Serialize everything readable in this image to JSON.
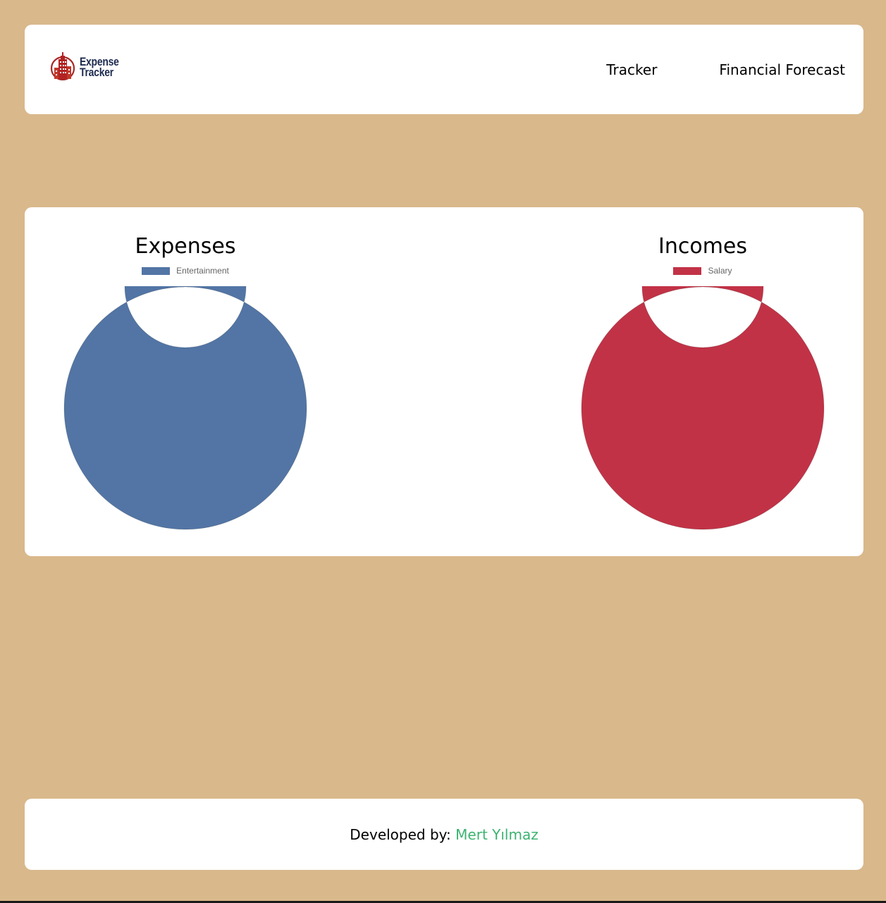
{
  "header": {
    "logo": {
      "line1": "Expense",
      "line2": "Tracker",
      "icon": "building-icon"
    },
    "nav": [
      {
        "label": "Tracker"
      },
      {
        "label": "Financial Forecast"
      }
    ]
  },
  "charts": {
    "expenses": {
      "title": "Expenses",
      "legend": "Entertainment",
      "color": "#5275a5"
    },
    "incomes": {
      "title": "Incomes",
      "legend": "Salary",
      "color": "#c23246"
    }
  },
  "chart_data": [
    {
      "type": "pie",
      "title": "Expenses",
      "categories": [
        "Entertainment"
      ],
      "values": [
        1
      ],
      "colors": [
        "#5275a5"
      ],
      "hole": 0.5,
      "legend": "top"
    },
    {
      "type": "pie",
      "title": "Incomes",
      "categories": [
        "Salary"
      ],
      "values": [
        1
      ],
      "colors": [
        "#c23246"
      ],
      "hole": 0.5,
      "legend": "top"
    }
  ],
  "footer": {
    "prefix": "Developed by:",
    "author": "Mert Yılmaz",
    "author_color": "#3cb371"
  }
}
